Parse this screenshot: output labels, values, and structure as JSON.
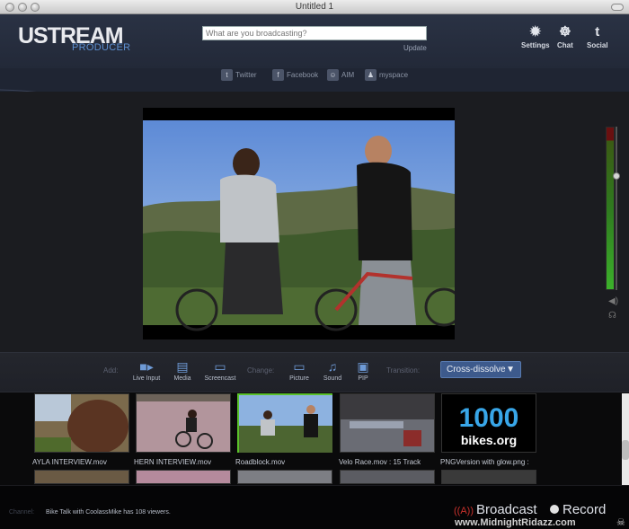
{
  "window": {
    "title": "Untitled 1"
  },
  "header": {
    "logo_main": "USTREAM",
    "logo_sub": "PRODUCER",
    "search_placeholder": "What are you broadcasting?",
    "update_label": "Update",
    "buttons": [
      {
        "label": "Settings",
        "icon": "gear-icon"
      },
      {
        "label": "Chat",
        "icon": "chat-icon"
      },
      {
        "label": "Social",
        "icon": "twitter-icon"
      }
    ],
    "share": [
      {
        "label": "Twitter",
        "icon": "twitter-icon"
      },
      {
        "label": "Facebook",
        "icon": "facebook-icon"
      },
      {
        "label": "AIM",
        "icon": "aim-icon"
      },
      {
        "label": "myspace",
        "icon": "myspace-icon"
      }
    ]
  },
  "toolbar": {
    "add_label": "Add:",
    "change_label": "Change:",
    "transition_label": "Transition:",
    "add_buttons": [
      {
        "label": "Live Input",
        "icon": "camera-icon"
      },
      {
        "label": "Media",
        "icon": "film-icon"
      },
      {
        "label": "Screencast",
        "icon": "monitor-icon"
      }
    ],
    "change_buttons": [
      {
        "label": "Picture",
        "icon": "picture-icon"
      },
      {
        "label": "Sound",
        "icon": "music-note-icon"
      },
      {
        "label": "PIP",
        "icon": "pip-icon"
      }
    ],
    "transition_value": "Cross-dissolve"
  },
  "library": {
    "items": [
      {
        "label": "AYLA INTERVIEW.mov"
      },
      {
        "label": "HERN INTERVIEW.mov"
      },
      {
        "label": "Roadblock.mov",
        "selected": true
      },
      {
        "label": "Velo Race.mov : 15 Track"
      },
      {
        "label": "PNGVersion with glow.png :"
      }
    ],
    "logo_text_top": "1000",
    "logo_text_bottom": "bikes.org"
  },
  "status": {
    "channel_label": "Channel:",
    "channel_text": "Bike Talk with CoolassMike has 108 viewers.",
    "broadcast_label": "Broadcast",
    "record_label": "Record"
  },
  "watermark": "www.MidnightRidazz.com",
  "colors": {
    "accent_blue": "#3d5a8c",
    "selected_border": "#5ac12a",
    "broadcast_red": "#c9312c"
  }
}
